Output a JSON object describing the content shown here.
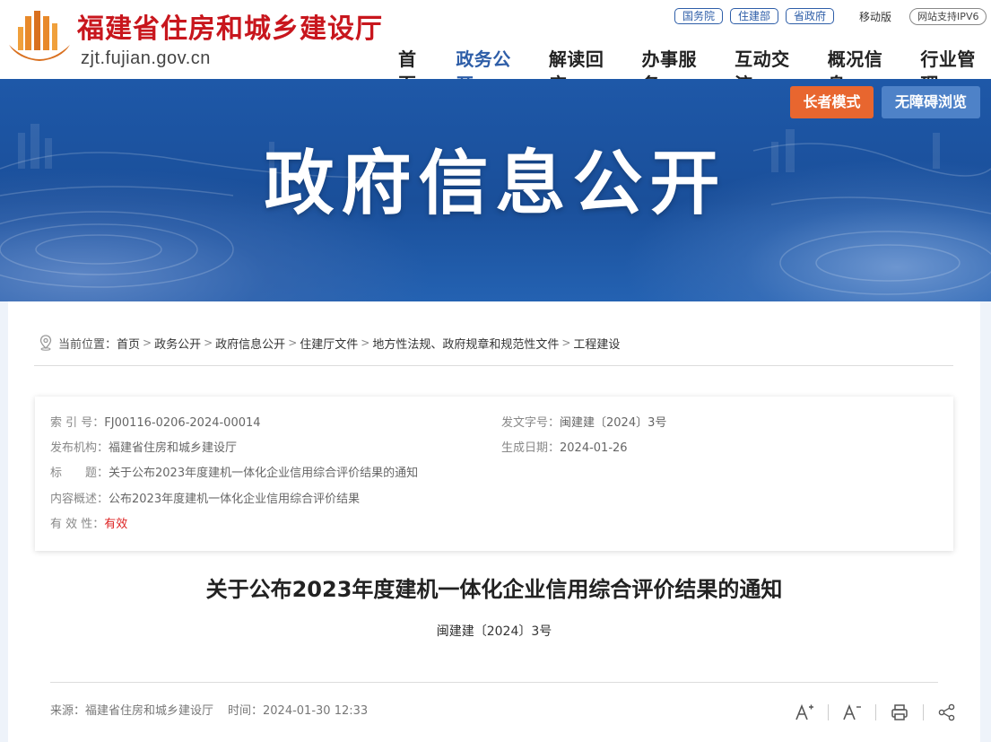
{
  "header": {
    "site_name": "福建省住房和城乡建设厅",
    "site_domain": "zjt.fujian.gov.cn",
    "top_links": [
      "国务院",
      "住建部",
      "省政府"
    ],
    "mobile_label": "移动版",
    "ipv6_label": "网站支持IPV6",
    "nav": [
      "首页",
      "政务公开",
      "解读回应",
      "办事服务",
      "互动交流",
      "概况信息",
      "行业管理"
    ],
    "active_nav": "政务公开"
  },
  "banner": {
    "title": "政府信息公开",
    "elder_mode_label": "长者模式",
    "accessible_label": "无障碍浏览"
  },
  "breadcrumb": {
    "prefix": "当前位置：",
    "items": [
      "首页",
      "政务公开",
      "政府信息公开",
      "住建厅文件",
      "地方性法规、政府规章和规范性文件",
      "工程建设"
    ]
  },
  "meta": {
    "index_label": "索 引 号：",
    "index_value": "FJ00116-0206-2024-00014",
    "doc_no_label": "发文字号：",
    "doc_no_value": "闽建建〔2024〕3号",
    "issuer_label": "发布机构：",
    "issuer_value": "福建省住房和城乡建设厅",
    "date_label": "生成日期：",
    "date_value": "2024-01-26",
    "title_label": "标　　题：",
    "title_value": "关于公布2023年度建机一体化企业信用综合评价结果的通知",
    "summary_label": "内容概述：",
    "summary_value": "公布2023年度建机一体化企业信用综合评价结果",
    "validity_label": "有 效 性：",
    "validity_value": "有效"
  },
  "document": {
    "title": "关于公布2023年度建机一体化企业信用综合评价结果的通知",
    "number": "闽建建〔2024〕3号",
    "source": "来源：福建省住房和城乡建设厅",
    "time": "时间：2024-01-30 12:33"
  },
  "colors": {
    "brand_red": "#c8161d",
    "nav_active": "#2e5ea8",
    "elder_button": "#e8662f",
    "accessible_button": "#4e82c8",
    "validity": "#dd2222"
  },
  "icons": [
    "logo-icon",
    "location-icon",
    "font-increase-icon",
    "font-decrease-icon",
    "print-icon",
    "share-icon"
  ]
}
